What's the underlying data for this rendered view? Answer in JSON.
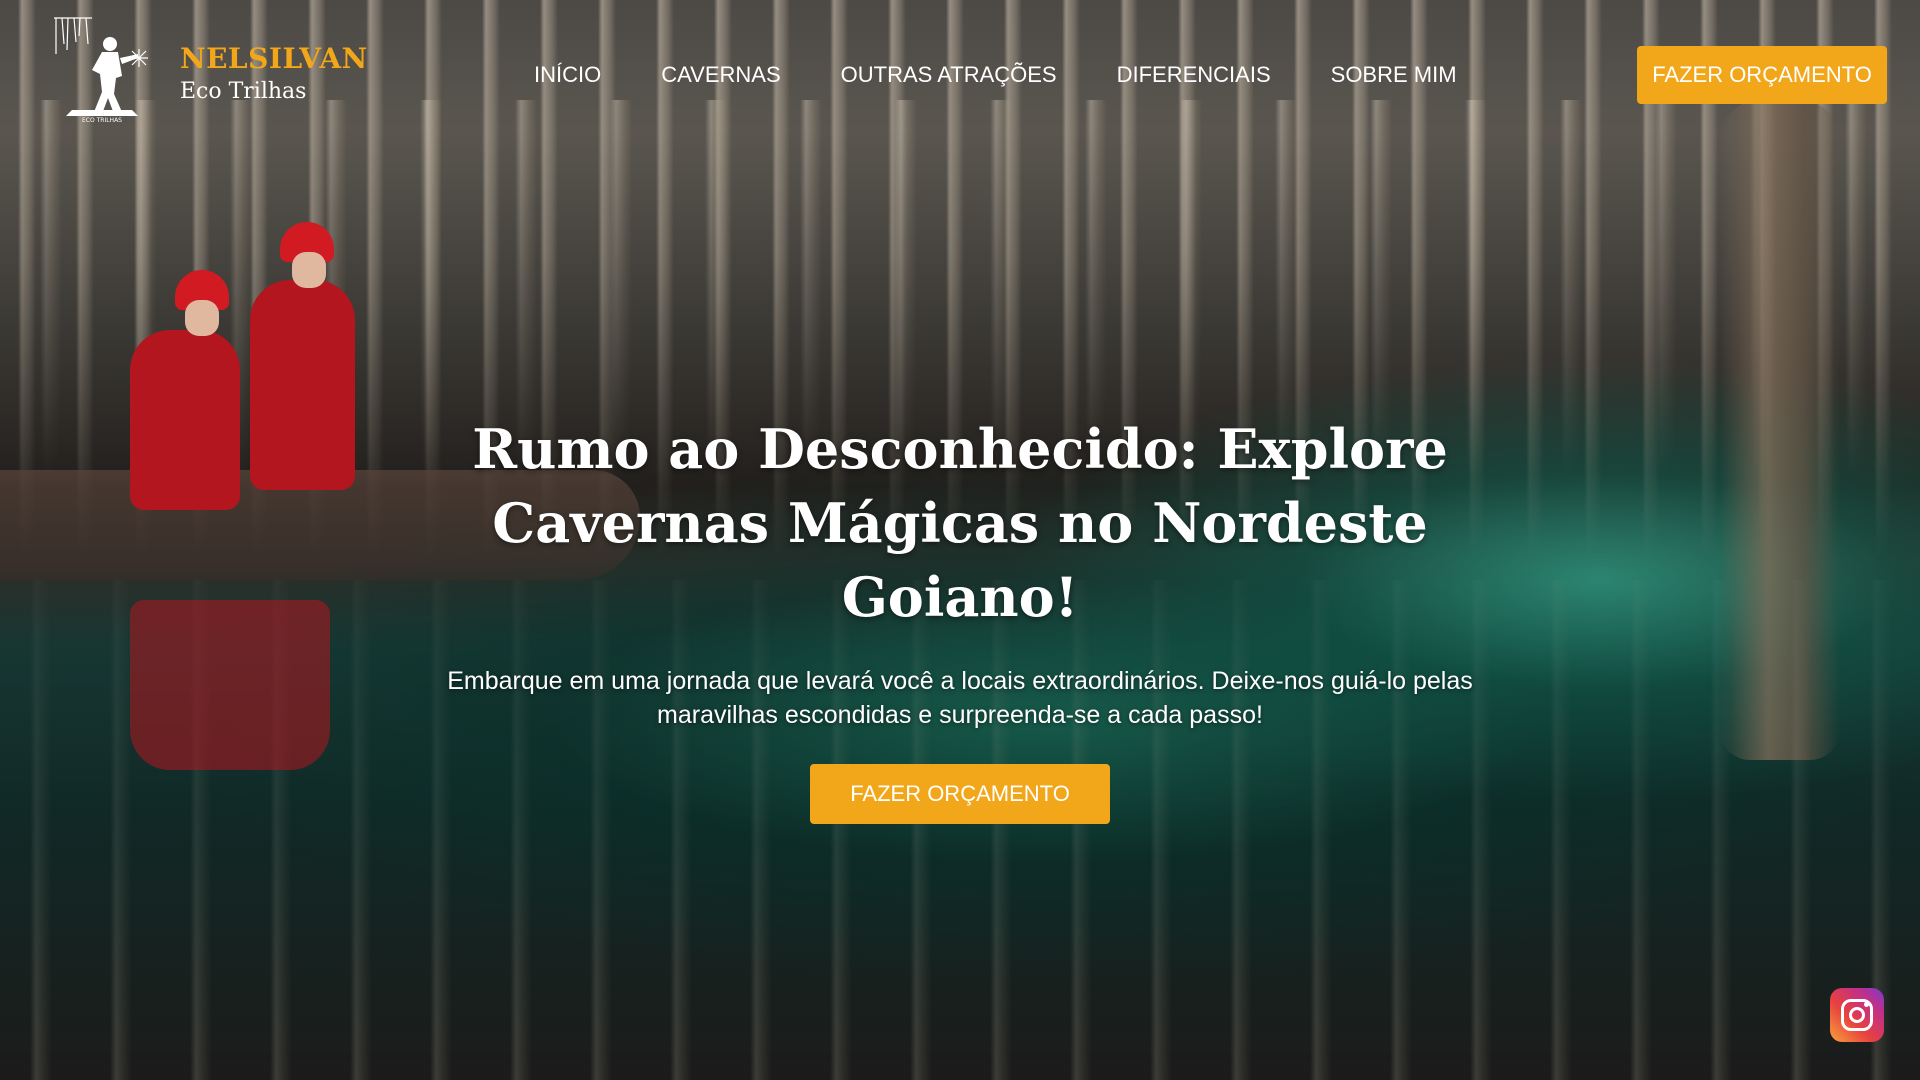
{
  "brand": {
    "name": "NELSILVAN",
    "subtitle": "Eco Trilhas",
    "accent_color": "#f2a71b",
    "logo_icon": "caver-silhouette-logo"
  },
  "nav": {
    "items": [
      {
        "label": "INÍCIO"
      },
      {
        "label": "CAVERNAS"
      },
      {
        "label": "OUTRAS ATRAÇÕES"
      },
      {
        "label": "DIFERENCIAIS"
      },
      {
        "label": "SOBRE MIM"
      }
    ],
    "cta_label": "FAZER ORÇAMENTO"
  },
  "hero": {
    "title": "Rumo ao Desconhecido: Explore Cavernas Mágicas no Nordeste Goiano!",
    "text": "Embarque em uma jornada que levará você a locais extraordinários. Deixe-nos guiá-lo pelas maravilhas escondidas e surpreenda-se a cada passo!",
    "cta_label": "FAZER ORÇAMENTO"
  },
  "floating": {
    "icon": "instagram-icon"
  }
}
